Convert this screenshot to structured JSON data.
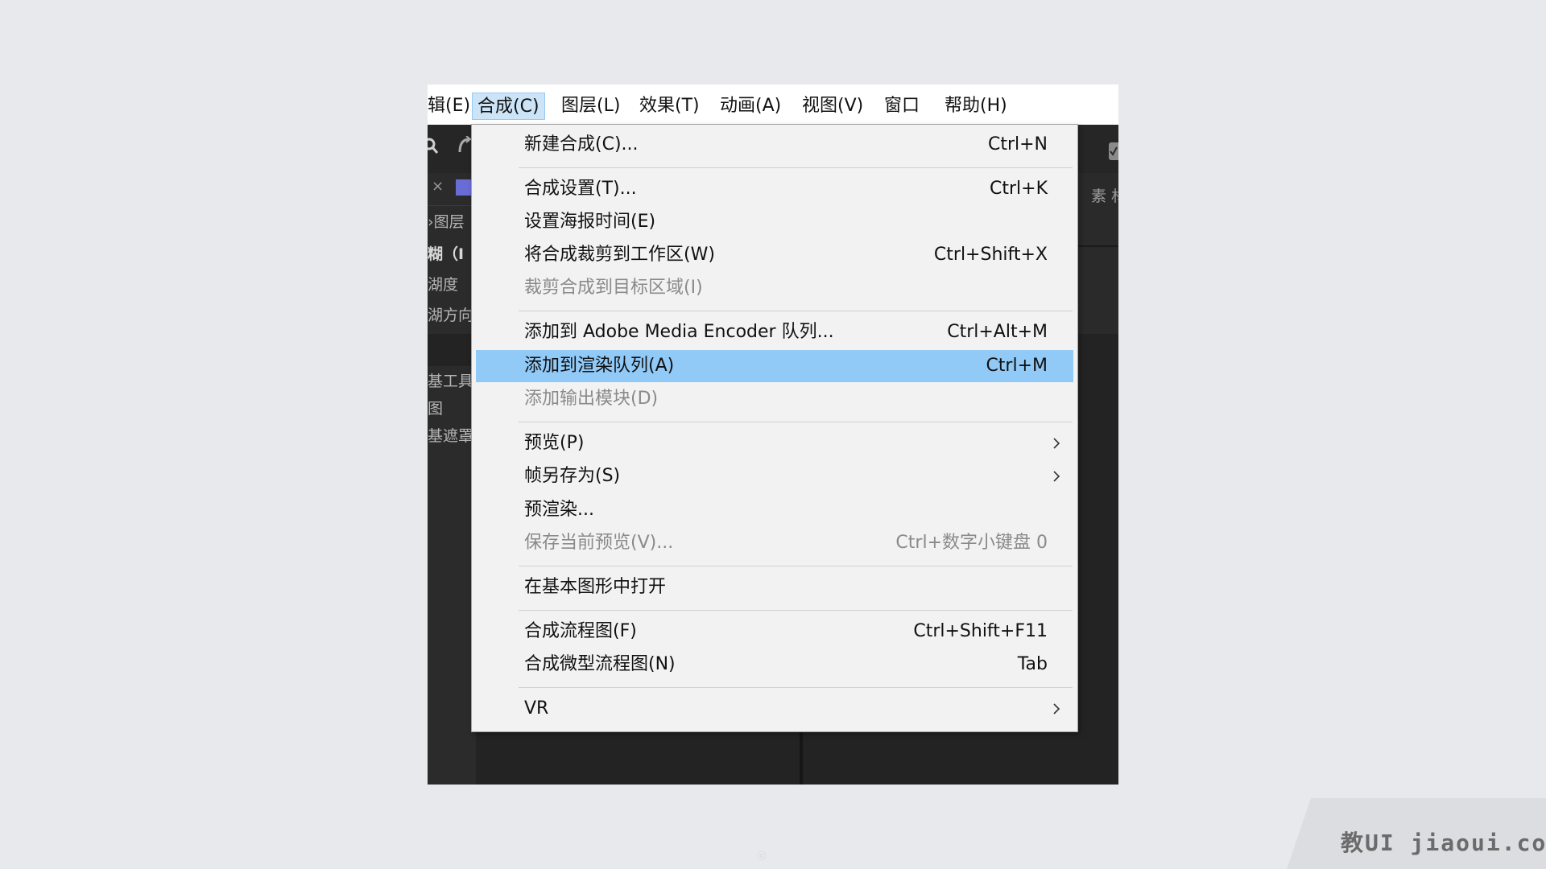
{
  "menubar": {
    "items": [
      {
        "label": "辑(E)"
      },
      {
        "label": "合成(C)",
        "active": true
      },
      {
        "label": "图层(L)"
      },
      {
        "label": "效果(T)"
      },
      {
        "label": "动画(A)"
      },
      {
        "label": "视图(V)"
      },
      {
        "label": "窗口"
      },
      {
        "label": "帮助(H)"
      }
    ]
  },
  "background_panel": {
    "left_labels": [
      "›图层",
      "糊（I",
      "湖度",
      "湖方向",
      "基工具",
      "图",
      "基遮罩"
    ],
    "close_glyph": "×",
    "right_tab_label": "素 材"
  },
  "composition_menu": {
    "items": [
      {
        "label": "新建合成(C)...",
        "shortcut": "Ctrl+N"
      },
      {
        "label": "合成设置(T)...",
        "shortcut": "Ctrl+K"
      },
      {
        "label": "设置海报时间(E)",
        "shortcut": ""
      },
      {
        "label": "将合成裁剪到工作区(W)",
        "shortcut": "Ctrl+Shift+X"
      },
      {
        "label": "裁剪合成到目标区域(I)",
        "shortcut": "",
        "disabled": true
      },
      {
        "label": "添加到 Adobe Media Encoder 队列...",
        "shortcut": "Ctrl+Alt+M"
      },
      {
        "label": "添加到渲染队列(A)",
        "shortcut": "Ctrl+M",
        "selected": true
      },
      {
        "label": "添加输出模块(D)",
        "shortcut": "",
        "disabled": true
      },
      {
        "label": "预览(P)",
        "submenu": true
      },
      {
        "label": "帧另存为(S)",
        "submenu": true
      },
      {
        "label": "预渲染...",
        "shortcut": ""
      },
      {
        "label": "保存当前预览(V)...",
        "shortcut": "Ctrl+数字小键盘 0",
        "disabled": true
      },
      {
        "label": "在基本图形中打开",
        "shortcut": ""
      },
      {
        "label": "合成流程图(F)",
        "shortcut": "Ctrl+Shift+F11"
      },
      {
        "label": "合成微型流程图(N)",
        "shortcut": "Tab"
      },
      {
        "label": "VR",
        "submenu": true
      }
    ]
  },
  "watermark": {
    "text": "教UI  jiaoui.com"
  },
  "colors": {
    "highlight": "#91c9f7",
    "menu_bg": "#f2f2f2",
    "disabled_text": "#8a8a8a",
    "dark_ui": "#232323",
    "page_bg": "#e8e9ec"
  }
}
